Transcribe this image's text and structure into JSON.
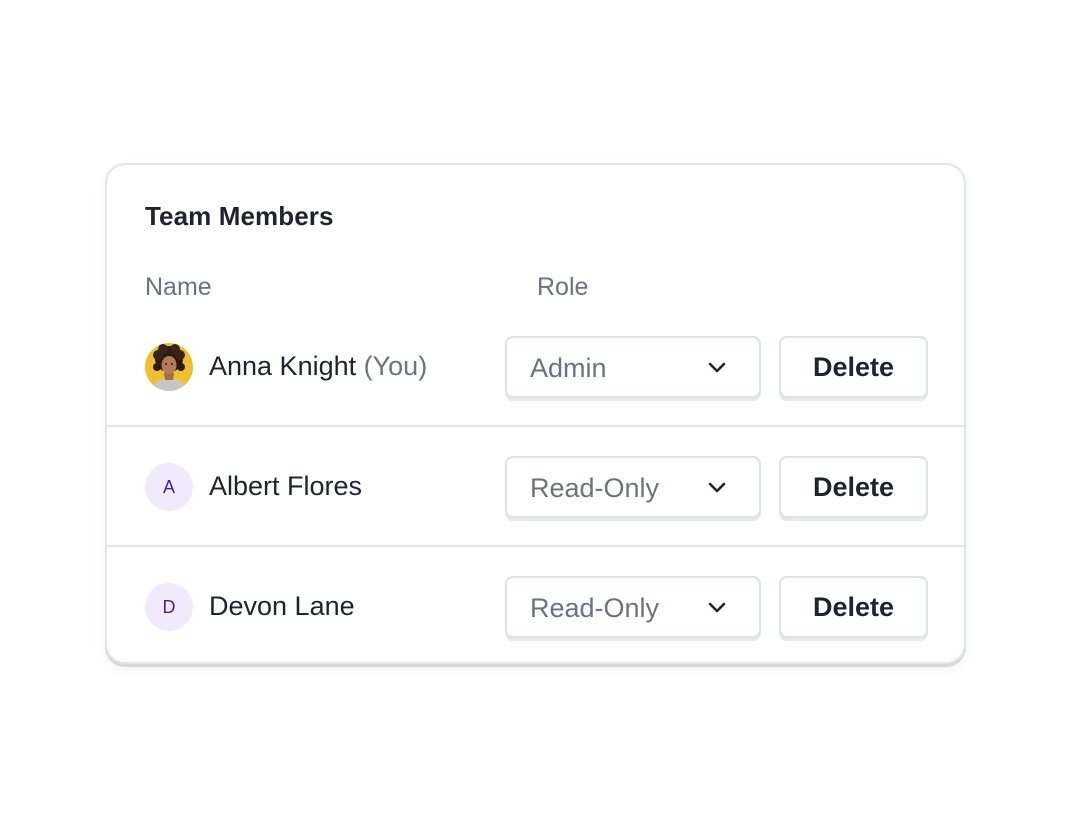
{
  "card": {
    "title": "Team Members",
    "columns": {
      "name": "Name",
      "role": "Role"
    }
  },
  "members": [
    {
      "name": "Anna Knight",
      "tag": "(You)",
      "avatar": "photo",
      "role": "Admin",
      "action": "Delete"
    },
    {
      "name": "Albert Flores",
      "tag": "",
      "avatar": "A",
      "role": "Read-Only",
      "action": "Delete"
    },
    {
      "name": "Devon Lane",
      "tag": "",
      "avatar": "D",
      "role": "Read-Only",
      "action": "Delete"
    }
  ],
  "icons": {
    "dropdown": "chevron-down-icon"
  },
  "colors": {
    "text": "#1e2330",
    "muted": "#6b7280",
    "avatar_bg": "#f1eafd",
    "avatar_letter": "#4c1d95",
    "border": "#e2e5e9"
  }
}
